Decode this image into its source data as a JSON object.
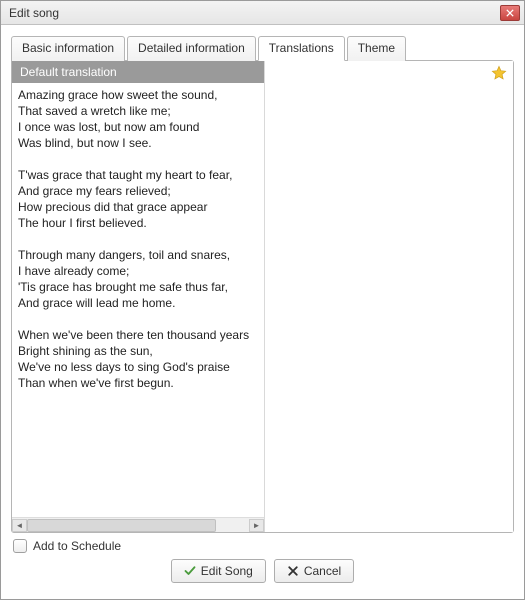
{
  "window": {
    "title": "Edit song"
  },
  "tabs": [
    {
      "label": "Basic information"
    },
    {
      "label": "Detailed information"
    },
    {
      "label": "Translations"
    },
    {
      "label": "Theme"
    }
  ],
  "activeTabIndex": 2,
  "translationPane": {
    "header": "Default translation",
    "lyrics": "Amazing grace how sweet the sound,\nThat saved a wretch like me;\nI once was lost, but now am found\nWas blind, but now I see.\n\nT'was grace that taught my heart to fear,\nAnd grace my fears relieved;\nHow precious did that grace appear\nThe hour I first believed.\n\nThrough many dangers, toil and snares,\nI have already come;\n'Tis grace has brought me safe thus far,\nAnd grace will lead me home.\n\nWhen we've been there ten thousand years\nBright shining as the sun,\nWe've no less days to sing God's praise\nThan when we've first begun."
  },
  "footer": {
    "addToSchedule": "Add to Schedule",
    "editSong": "Edit Song",
    "cancel": "Cancel"
  },
  "icons": {
    "star": "star-icon",
    "check": "check-icon",
    "x": "x-icon",
    "close": "close-icon"
  }
}
